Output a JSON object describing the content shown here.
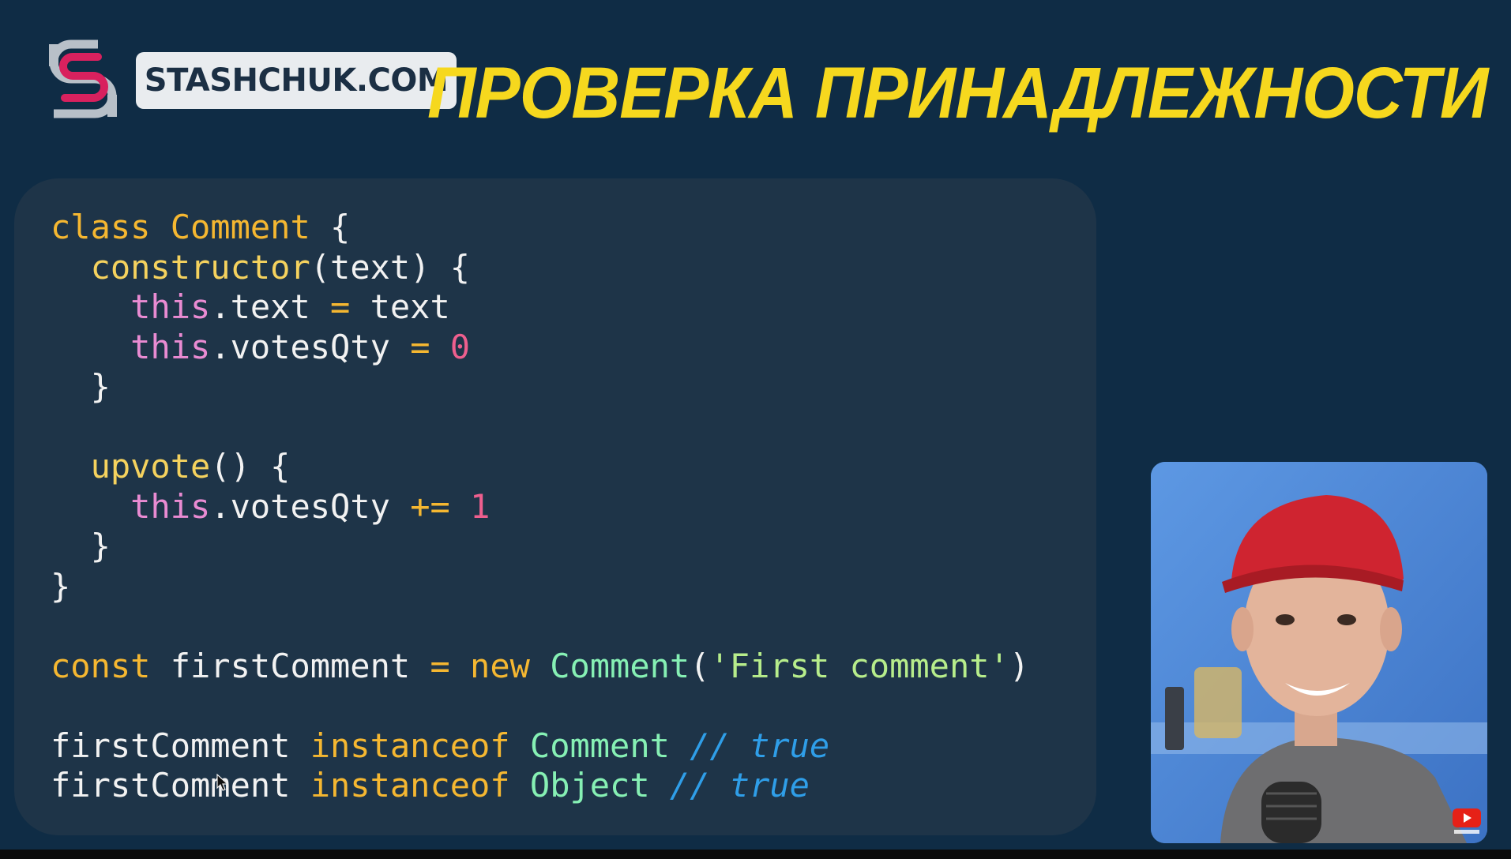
{
  "brand": {
    "logo_text": "STASHCHUK.COM",
    "logo_icon": "stashchuk-s-logo-icon"
  },
  "title": "ПРОВЕРКА ПРИНАДЛЕЖНОСТИ",
  "colors": {
    "background": "#0f2c45",
    "code_panel": "#1e3448",
    "title": "#f6d81e",
    "keyword": "#f5b731",
    "this": "#e98bd2",
    "number": "#ee5f8e",
    "identifier": "#86f0b4",
    "string": "#b7ed8b",
    "comment": "#2f9ee8"
  },
  "code": {
    "line1": {
      "kw": "class",
      "name": "Comment",
      "brace": " {"
    },
    "line2": {
      "fn": "constructor",
      "open": "(",
      "arg": "text",
      "close": ") {"
    },
    "line3": {
      "th": "this",
      "prop": ".text ",
      "op": "=",
      "rest": " text"
    },
    "line4": {
      "th": "this",
      "prop": ".votesQty ",
      "op": "=",
      "num": "0"
    },
    "line5": {
      "brace": "}"
    },
    "line7": {
      "fn": "upvote",
      "paren": "()",
      "brace": " {"
    },
    "line8": {
      "th": "this",
      "prop": ".votesQty ",
      "op": "+=",
      "num": "1"
    },
    "line9": {
      "brace": "}"
    },
    "line10": {
      "brace": "}"
    },
    "line12": {
      "kw": "const",
      "var": " firstComment ",
      "op": "=",
      "kw2": "new",
      "cls": "Comment",
      "open": "(",
      "str": "'First comment'",
      "close": ")"
    },
    "line14": {
      "var": "firstComment ",
      "kw": "instanceof",
      "cls": "Comment",
      "comment": "// true"
    },
    "line15": {
      "var": "firstComment ",
      "kw": "instanceof",
      "cls": "Object",
      "comment": "// true"
    }
  },
  "video": {
    "subscribe_icon": "youtube-subscribe-icon"
  },
  "cursor": "mouse-pointer-icon"
}
